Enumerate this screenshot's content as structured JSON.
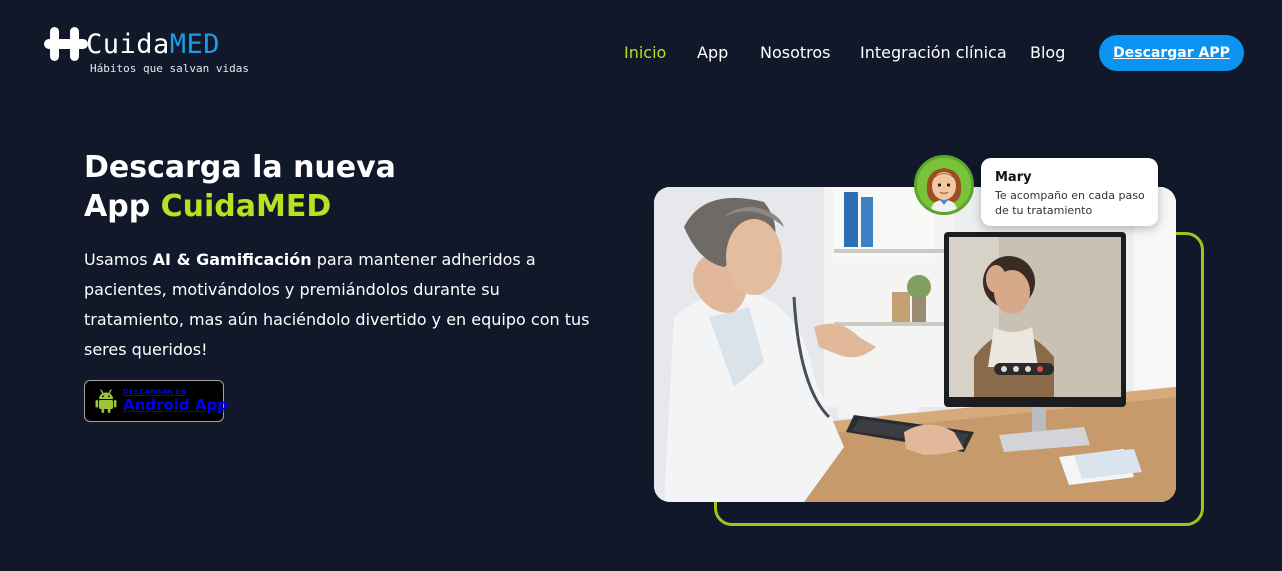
{
  "brand": {
    "name_part1": "Cuida",
    "name_part2": "MED",
    "tagline": "Hábitos que salvan vidas",
    "colors": {
      "accent_blue": "#1e9be9",
      "accent_green": "#b6e223",
      "background": "#10182a"
    }
  },
  "nav": {
    "items": [
      {
        "label": "Inicio",
        "active": true
      },
      {
        "label": "App",
        "active": false
      },
      {
        "label": "Nosotros",
        "active": false
      },
      {
        "label": "Integración clínica",
        "active": false
      },
      {
        "label": "Blog",
        "active": false
      }
    ],
    "cta_label": "Descargar APP"
  },
  "hero": {
    "title_line1": "Descarga la nueva",
    "title_line2_prefix": "App ",
    "title_line2_accent": "CuidaMED",
    "desc_prefix": "Usamos ",
    "desc_bold": "AI & Gamificación",
    "desc_rest": " para mantener adheridos a pacientes, motivándolos y premiándolos durante su tratamiento, mas aún haciéndolo divertido y en equipo con tus seres queridos!",
    "badge_small": "DESCARGAR EN",
    "badge_big": "Android App",
    "badge_icon": "android-icon"
  },
  "chat": {
    "name": "Mary",
    "message": "Te acompaño en cada paso de tu tratamiento"
  }
}
